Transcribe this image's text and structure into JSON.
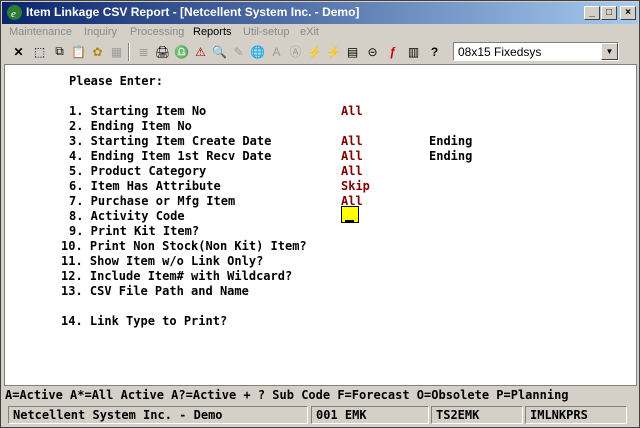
{
  "window": {
    "title": "Item Linkage CSV Report - [Netcellent System Inc. - Demo]",
    "min_label": "_",
    "max_label": "□",
    "close_label": "×"
  },
  "menu": [
    "Maintenance",
    "Inquiry",
    "Processing",
    "Reports",
    "Util-setup",
    "eXit"
  ],
  "toolbar": {
    "font_select_value": "08x15 Fixedsys"
  },
  "form": {
    "heading": "Please Enter:",
    "fields": [
      {
        "label": "1. Starting Item No",
        "value": "All",
        "extra": ""
      },
      {
        "label": "2. Ending Item No",
        "value": "",
        "extra": ""
      },
      {
        "label": "3. Starting Item Create Date",
        "value": "All",
        "extra": "Ending"
      },
      {
        "label": "4. Ending Item 1st Recv Date",
        "value": "All",
        "extra": "Ending"
      },
      {
        "label": "5. Product Category",
        "value": "All",
        "extra": ""
      },
      {
        "label": "6. Item Has Attribute",
        "value": "Skip",
        "extra": ""
      },
      {
        "label": "7. Purchase or Mfg Item",
        "value": "All",
        "extra": ""
      },
      {
        "label": "8. Activity Code",
        "value": "",
        "extra": ""
      },
      {
        "label": "9. Print Kit Item?",
        "value": "",
        "extra": ""
      },
      {
        "label": "10. Print Non Stock(Non Kit) Item?",
        "value": "",
        "extra": ""
      },
      {
        "label": "11. Show Item w/o Link Only?",
        "value": "",
        "extra": ""
      },
      {
        "label": "12. Include Item# with Wildcard?",
        "value": "",
        "extra": ""
      },
      {
        "label": "13. CSV File Path and Name",
        "value": "",
        "extra": ""
      },
      {
        "label": "14. Link Type to Print?",
        "value": "",
        "extra": ""
      }
    ]
  },
  "hint": "A=Active A*=All Active A?=Active + ? Sub Code F=Forecast O=Obsolete P=Planning",
  "status": {
    "company": "Netcellent System Inc. - Demo",
    "user": "001 EMK",
    "station": "TS2EMK",
    "program": "IMLNKPRS"
  },
  "colors": {
    "title_start": "#0a246a",
    "value_text": "#800000",
    "cursor_bg": "#ffff00"
  }
}
